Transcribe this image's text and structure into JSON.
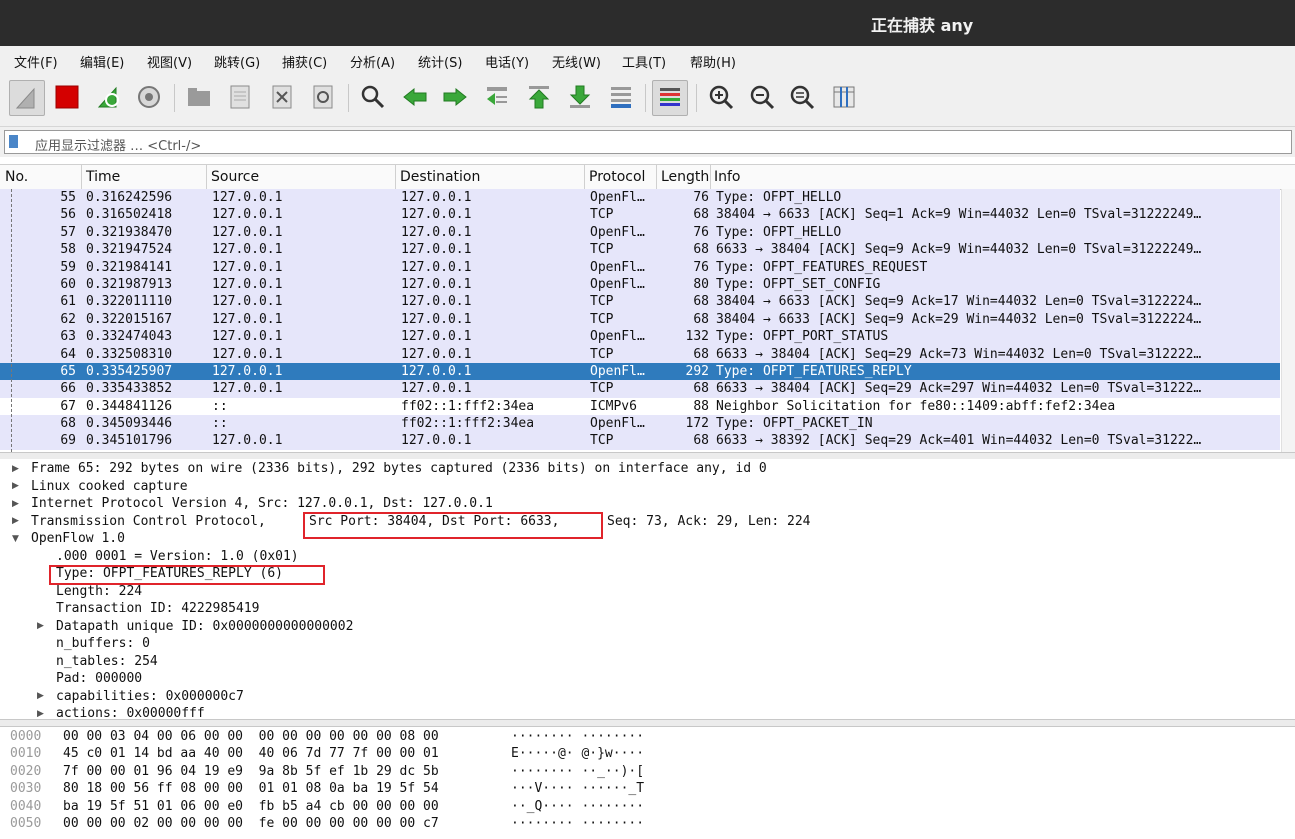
{
  "window": {
    "title": "正在捕获 any"
  },
  "menu": [
    "文件(F)",
    "编辑(E)",
    "视图(V)",
    "跳转(G)",
    "捕获(C)",
    "分析(A)",
    "统计(S)",
    "电话(Y)",
    "无线(W)",
    "工具(T)",
    "帮助(H)"
  ],
  "toolbar": {
    "icons": [
      "shark-fin-start-icon",
      "stop-capture-icon",
      "restart-capture-icon",
      "capture-options-icon",
      "open-file-icon",
      "save-file-icon",
      "close-file-icon",
      "reload-file-icon",
      "find-packet-icon",
      "go-back-icon",
      "go-forward-icon",
      "go-to-packet-icon",
      "go-first-icon",
      "go-last-icon",
      "auto-scroll-icon",
      "colorize-icon",
      "zoom-in-icon",
      "zoom-out-icon",
      "zoom-normal-icon",
      "resize-columns-icon"
    ]
  },
  "filter": {
    "placeholder": "应用显示过滤器 … <Ctrl-/>"
  },
  "packet_list": {
    "columns": [
      "No.",
      "Time",
      "Source",
      "Destination",
      "Protocol",
      "Length",
      "Info"
    ],
    "rows": [
      {
        "no": "55",
        "time": "0.316242596",
        "src": "127.0.0.1",
        "dst": "127.0.0.1",
        "proto": "OpenFl…",
        "len": "76",
        "info": "Type: OFPT_HELLO",
        "kind": "openflow"
      },
      {
        "no": "56",
        "time": "0.316502418",
        "src": "127.0.0.1",
        "dst": "127.0.0.1",
        "proto": "TCP",
        "len": "68",
        "info": "38404 → 6633 [ACK] Seq=1 Ack=9 Win=44032 Len=0 TSval=31222249…",
        "kind": "tcp"
      },
      {
        "no": "57",
        "time": "0.321938470",
        "src": "127.0.0.1",
        "dst": "127.0.0.1",
        "proto": "OpenFl…",
        "len": "76",
        "info": "Type: OFPT_HELLO",
        "kind": "openflow"
      },
      {
        "no": "58",
        "time": "0.321947524",
        "src": "127.0.0.1",
        "dst": "127.0.0.1",
        "proto": "TCP",
        "len": "68",
        "info": "6633 → 38404 [ACK] Seq=9 Ack=9 Win=44032 Len=0 TSval=31222249…",
        "kind": "tcp"
      },
      {
        "no": "59",
        "time": "0.321984141",
        "src": "127.0.0.1",
        "dst": "127.0.0.1",
        "proto": "OpenFl…",
        "len": "76",
        "info": "Type: OFPT_FEATURES_REQUEST",
        "kind": "openflow"
      },
      {
        "no": "60",
        "time": "0.321987913",
        "src": "127.0.0.1",
        "dst": "127.0.0.1",
        "proto": "OpenFl…",
        "len": "80",
        "info": "Type: OFPT_SET_CONFIG",
        "kind": "openflow"
      },
      {
        "no": "61",
        "time": "0.322011110",
        "src": "127.0.0.1",
        "dst": "127.0.0.1",
        "proto": "TCP",
        "len": "68",
        "info": "38404 → 6633 [ACK] Seq=9 Ack=17 Win=44032 Len=0 TSval=3122224…",
        "kind": "tcp"
      },
      {
        "no": "62",
        "time": "0.322015167",
        "src": "127.0.0.1",
        "dst": "127.0.0.1",
        "proto": "TCP",
        "len": "68",
        "info": "38404 → 6633 [ACK] Seq=9 Ack=29 Win=44032 Len=0 TSval=3122224…",
        "kind": "tcp"
      },
      {
        "no": "63",
        "time": "0.332474043",
        "src": "127.0.0.1",
        "dst": "127.0.0.1",
        "proto": "OpenFl…",
        "len": "132",
        "info": "Type: OFPT_PORT_STATUS",
        "kind": "openflow"
      },
      {
        "no": "64",
        "time": "0.332508310",
        "src": "127.0.0.1",
        "dst": "127.0.0.1",
        "proto": "TCP",
        "len": "68",
        "info": "6633 → 38404 [ACK] Seq=29 Ack=73 Win=44032 Len=0 TSval=312222…",
        "kind": "tcp"
      },
      {
        "no": "65",
        "time": "0.335425907",
        "src": "127.0.0.1",
        "dst": "127.0.0.1",
        "proto": "OpenFl…",
        "len": "292",
        "info": "Type: OFPT_FEATURES_REPLY",
        "kind": "selected"
      },
      {
        "no": "66",
        "time": "0.335433852",
        "src": "127.0.0.1",
        "dst": "127.0.0.1",
        "proto": "TCP",
        "len": "68",
        "info": "6633 → 38404 [ACK] Seq=29 Ack=297 Win=44032 Len=0 TSval=31222…",
        "kind": "tcp"
      },
      {
        "no": "67",
        "time": "0.344841126",
        "src": "::",
        "dst": "ff02::1:fff2:34ea",
        "proto": "ICMPv6",
        "len": "88",
        "info": "Neighbor Solicitation for fe80::1409:abff:fef2:34ea",
        "kind": "icmpv6"
      },
      {
        "no": "68",
        "time": "0.345093446",
        "src": "::",
        "dst": "ff02::1:fff2:34ea",
        "proto": "OpenFl…",
        "len": "172",
        "info": "Type: OFPT_PACKET_IN",
        "kind": "openflow"
      },
      {
        "no": "69",
        "time": "0.345101796",
        "src": "127.0.0.1",
        "dst": "127.0.0.1",
        "proto": "TCP",
        "len": "68",
        "info": "6633 → 38392 [ACK] Seq=29 Ack=401 Win=44032 Len=0 TSval=31222…",
        "kind": "tcp"
      }
    ]
  },
  "details": {
    "frame": "Frame 65: 292 bytes on wire (2336 bits), 292 bytes captured (2336 bits) on interface any, id 0",
    "linux": "Linux cooked capture",
    "ip": "Internet Protocol Version 4, Src: 127.0.0.1, Dst: 127.0.0.1",
    "tcp_prefix": "Transmission Control Protocol,",
    "tcp_ports": "Src Port: 38404, Dst Port: 6633,",
    "tcp_suffix": "Seq: 73, Ack: 29, Len: 224",
    "openflow": "OpenFlow 1.0",
    "version": ".000 0001 = Version: 1.0 (0x01)",
    "type": "Type: OFPT_FEATURES_REPLY (6)",
    "length": "Length: 224",
    "xid": "Transaction ID: 4222985419",
    "datapath": "Datapath unique ID: 0x0000000000000002",
    "n_buffers": "n_buffers: 0",
    "n_tables": "n_tables: 254",
    "pad": "Pad: 000000",
    "capabilities": "capabilities: 0x000000c7",
    "actions": "actions: 0x00000fff"
  },
  "hex": [
    {
      "off": "0000",
      "bytes": "00 00 03 04 00 06 00 00  00 00 00 00 00 00 08 00",
      "ascii": "········ ········"
    },
    {
      "off": "0010",
      "bytes": "45 c0 01 14 bd aa 40 00  40 06 7d 77 7f 00 00 01",
      "ascii": "E·····@· @·}w····"
    },
    {
      "off": "0020",
      "bytes": "7f 00 00 01 96 04 19 e9  9a 8b 5f ef 1b 29 dc 5b",
      "ascii": "········ ··_··)·["
    },
    {
      "off": "0030",
      "bytes": "80 18 00 56 ff 08 00 00  01 01 08 0a ba 19 5f 54",
      "ascii": "···V···· ······_T"
    },
    {
      "off": "0040",
      "bytes": "ba 19 5f 51 01 06 00 e0  fb b5 a4 cb 00 00 00 00",
      "ascii": "··_Q···· ········"
    },
    {
      "off": "0050",
      "bytes": "00 00 00 02 00 00 00 00  fe 00 00 00 00 00 00 c7",
      "ascii": "········ ········"
    }
  ]
}
